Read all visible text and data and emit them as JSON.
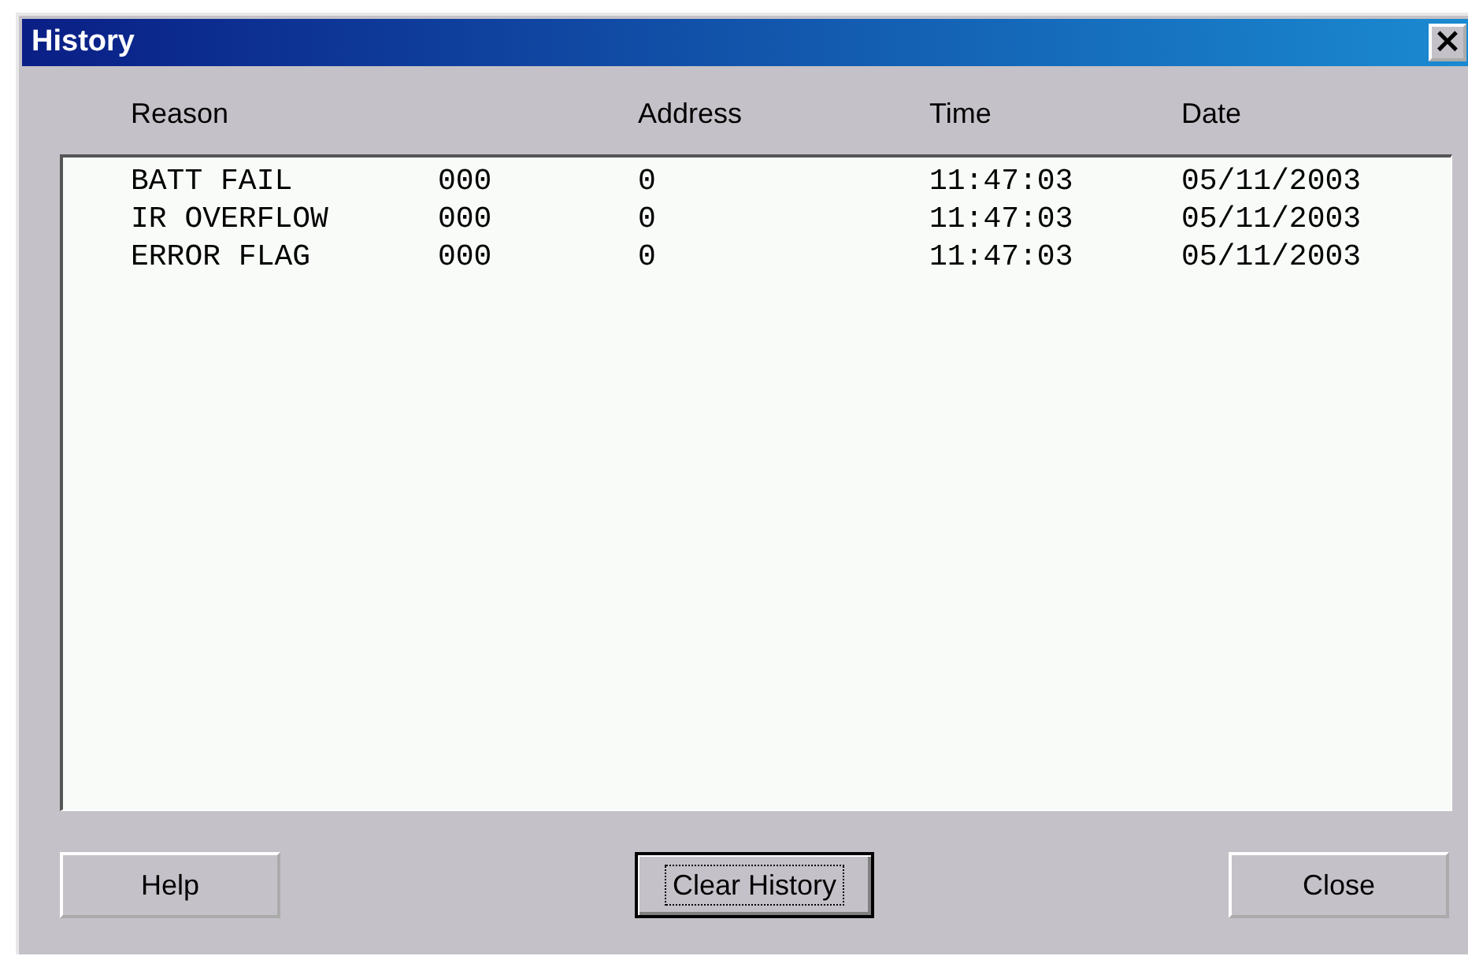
{
  "window": {
    "title": "History",
    "close": "×"
  },
  "columns": [
    "Reason",
    "Address",
    "Time",
    "Date"
  ],
  "rows": [
    {
      "reason": "BATT FAIL",
      "code": "000",
      "address": "0",
      "time": "11:47:03",
      "date": "05/11/2003"
    },
    {
      "reason": "IR OVERFLOW",
      "code": "000",
      "address": "0",
      "time": "11:47:03",
      "date": "05/11/2003"
    },
    {
      "reason": "ERROR FLAG",
      "code": "000",
      "address": "0",
      "time": "11:47:03",
      "date": "05/11/2003"
    }
  ],
  "buttons": [
    {
      "label": "Help",
      "default": false
    },
    {
      "label": "Clear History",
      "default": true
    },
    {
      "label": "Close",
      "default": false
    }
  ]
}
